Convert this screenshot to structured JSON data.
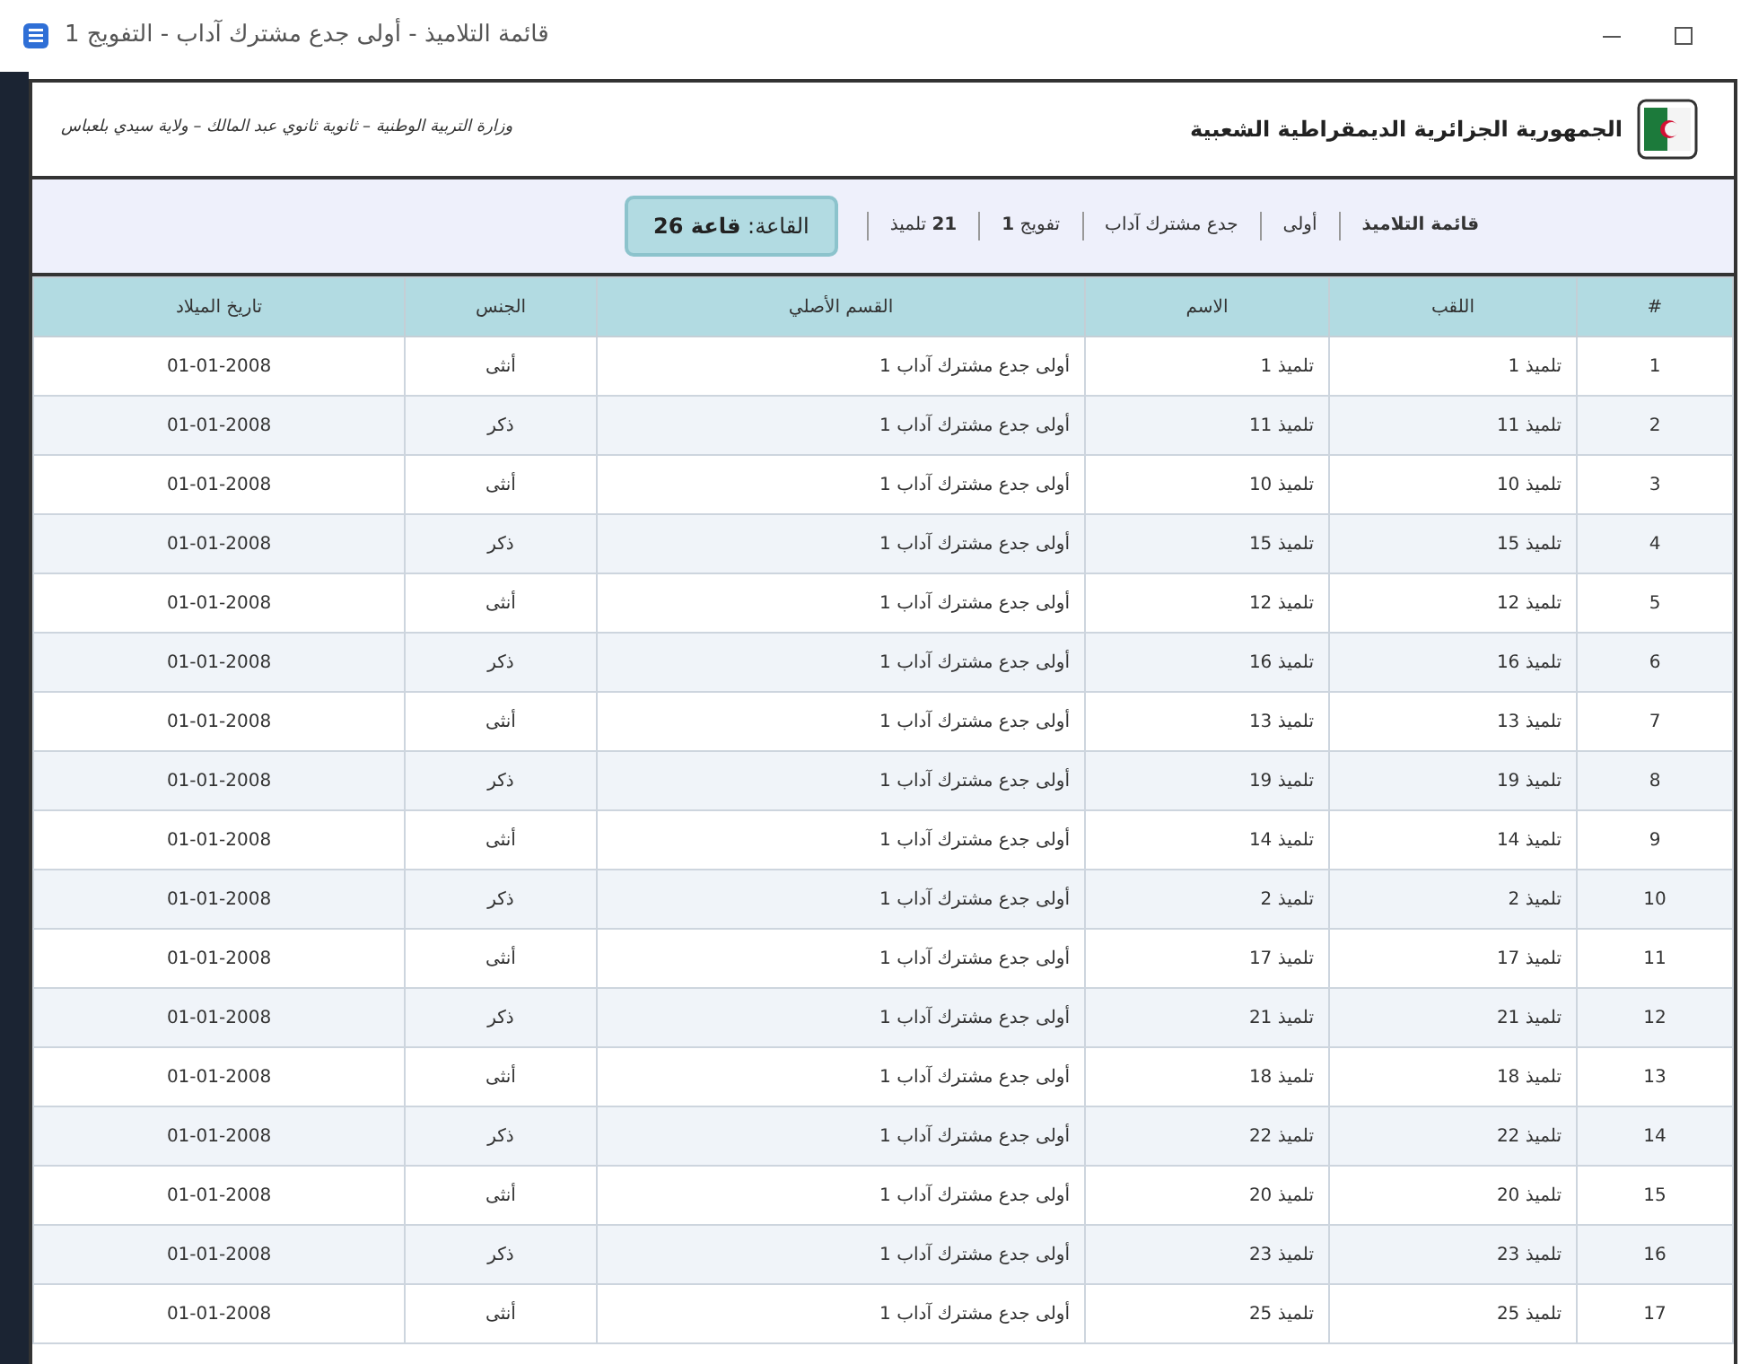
{
  "window": {
    "title": "قائمة التلاميذ - أولى جدع مشترك آداب - التفويج 1"
  },
  "header": {
    "country": "الجمهورية الجزائرية الديمقراطية الشعبية",
    "institution": "وزارة التربية الوطنية  –  ثانوية ثانوي عبد المالك – ولاية سيدي بلعباس"
  },
  "info_bar": {
    "items": [
      "**قائمة التلاميذ**",
      "أولى",
      "جدع مشترك آداب",
      "تفويج **1**",
      "**21** تلميذ"
    ],
    "room": "القاعة: **قاعة 26**"
  },
  "table": {
    "columns": [
      "#",
      "اللقب",
      "الاسم",
      "القسم الأصلي",
      "الجنس",
      "تاريخ الميلاد"
    ],
    "rows": [
      [
        "1",
        "تلميذ 1",
        "تلميذ 1",
        "أولى جدع مشترك آداب 1",
        "أنثى",
        "01-01-2008"
      ],
      [
        "2",
        "تلميذ 11",
        "تلميذ 11",
        "أولى جدع مشترك آداب 1",
        "ذكر",
        "01-01-2008"
      ],
      [
        "3",
        "تلميذ 10",
        "تلميذ 10",
        "أولى جدع مشترك آداب 1",
        "أنثى",
        "01-01-2008"
      ],
      [
        "4",
        "تلميذ 15",
        "تلميذ 15",
        "أولى جدع مشترك آداب 1",
        "ذكر",
        "01-01-2008"
      ],
      [
        "5",
        "تلميذ 12",
        "تلميذ 12",
        "أولى جدع مشترك آداب 1",
        "أنثى",
        "01-01-2008"
      ],
      [
        "6",
        "تلميذ 16",
        "تلميذ 16",
        "أولى جدع مشترك آداب 1",
        "ذكر",
        "01-01-2008"
      ],
      [
        "7",
        "تلميذ 13",
        "تلميذ 13",
        "أولى جدع مشترك آداب 1",
        "أنثى",
        "01-01-2008"
      ],
      [
        "8",
        "تلميذ 19",
        "تلميذ 19",
        "أولى جدع مشترك آداب 1",
        "ذكر",
        "01-01-2008"
      ],
      [
        "9",
        "تلميذ 14",
        "تلميذ 14",
        "أولى جدع مشترك آداب 1",
        "أنثى",
        "01-01-2008"
      ],
      [
        "10",
        "تلميذ 2",
        "تلميذ 2",
        "أولى جدع مشترك آداب 1",
        "ذكر",
        "01-01-2008"
      ],
      [
        "11",
        "تلميذ 17",
        "تلميذ 17",
        "أولى جدع مشترك آداب 1",
        "أنثى",
        "01-01-2008"
      ],
      [
        "12",
        "تلميذ 21",
        "تلميذ 21",
        "أولى جدع مشترك آداب 1",
        "ذكر",
        "01-01-2008"
      ],
      [
        "13",
        "تلميذ 18",
        "تلميذ 18",
        "أولى جدع مشترك آداب 1",
        "أنثى",
        "01-01-2008"
      ],
      [
        "14",
        "تلميذ 22",
        "تلميذ 22",
        "أولى جدع مشترك آداب 1",
        "ذكر",
        "01-01-2008"
      ],
      [
        "15",
        "تلميذ 20",
        "تلميذ 20",
        "أولى جدع مشترك آداب 1",
        "أنثى",
        "01-01-2008"
      ],
      [
        "16",
        "تلميذ 23",
        "تلميذ 23",
        "أولى جدع مشترك آداب 1",
        "ذكر",
        "01-01-2008"
      ],
      [
        "17",
        "تلميذ 25",
        "تلميذ 25",
        "أولى جدع مشترك آداب 1",
        "أنثى",
        "01-01-2008"
      ]
    ]
  }
}
